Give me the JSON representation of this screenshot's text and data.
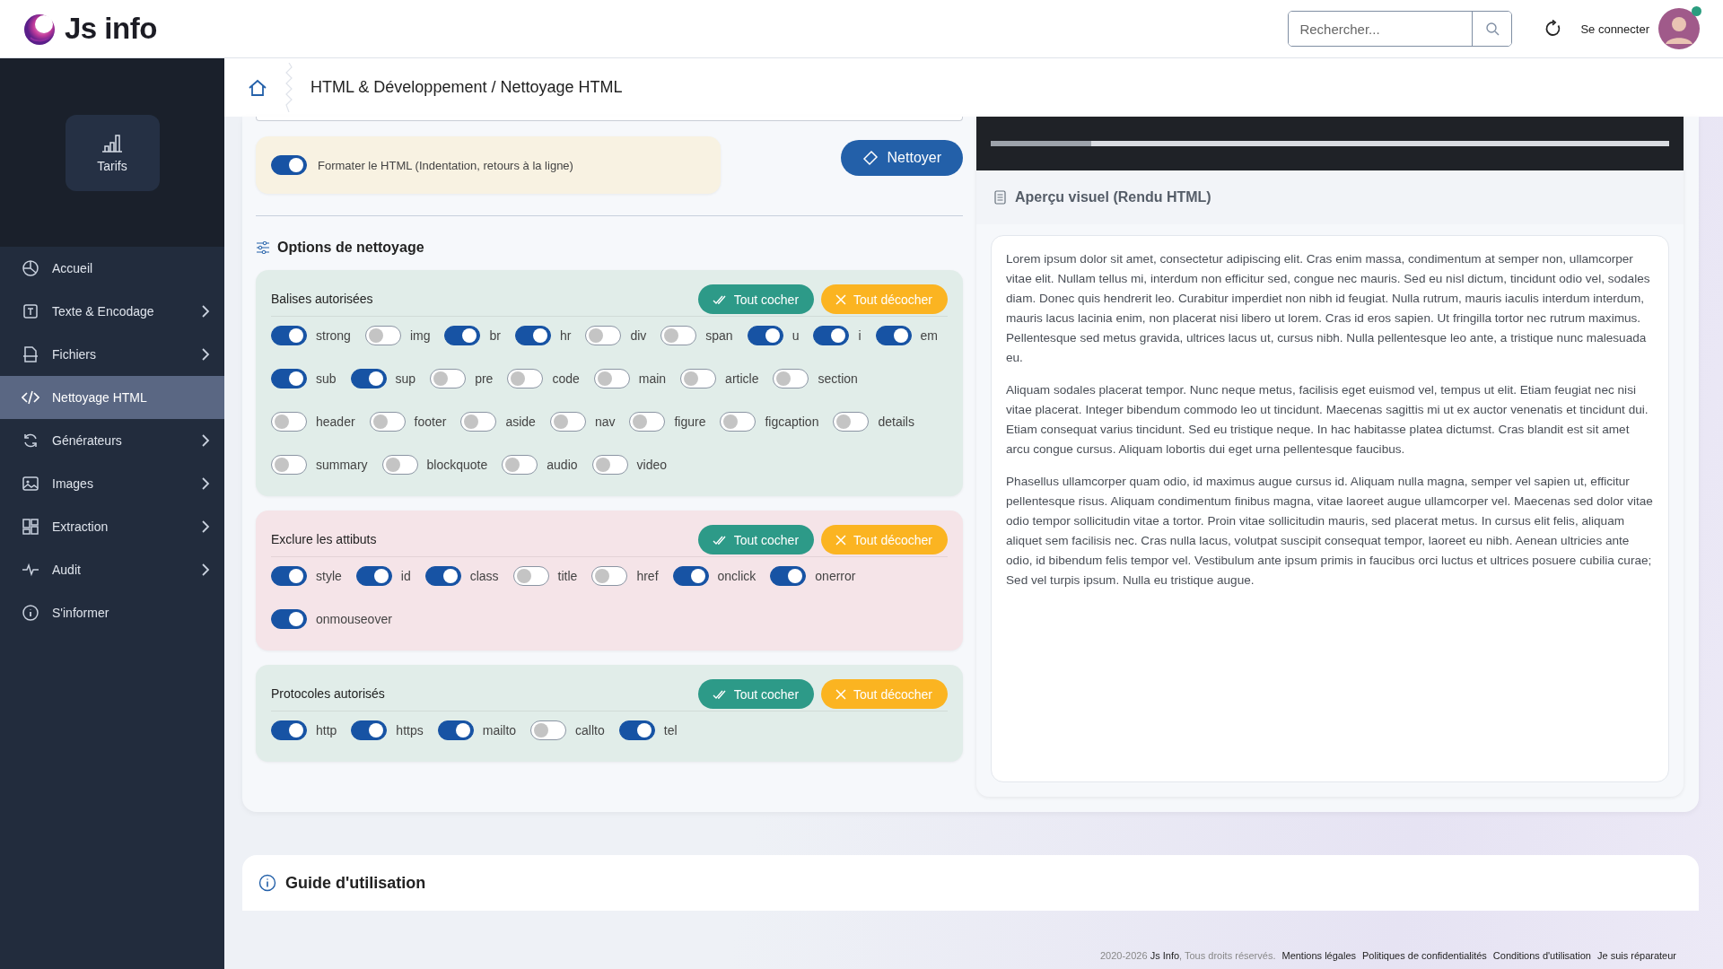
{
  "header": {
    "logo": "Js info",
    "search": {
      "placeholder": "Rechercher..."
    },
    "login": "Se connecter",
    "avatar": {
      "online": true
    }
  },
  "sidebar": {
    "promo": "Tarifs",
    "items": [
      {
        "label": "Accueil",
        "submenu": false,
        "selected": false
      },
      {
        "label": "Texte & Encodage",
        "submenu": true,
        "selected": false
      },
      {
        "label": "Fichiers",
        "submenu": true,
        "selected": false
      },
      {
        "label": "Nettoyage HTML",
        "submenu": false,
        "selected": true
      },
      {
        "label": "Générateurs",
        "submenu": true,
        "selected": false
      },
      {
        "label": "Images",
        "submenu": true,
        "selected": false
      },
      {
        "label": "Extraction",
        "submenu": true,
        "selected": false
      },
      {
        "label": "Audit",
        "submenu": true,
        "selected": false
      },
      {
        "label": "S'informer",
        "submenu": false,
        "selected": false
      }
    ]
  },
  "breadcrumb": "HTML & Développement / Nettoyage HTML",
  "format_option": {
    "label": "Formater le HTML (Indentation, retours à la ligne)",
    "on": true
  },
  "clean_button": "Nettoyer",
  "options_title": "Options de nettoyage",
  "groups": [
    {
      "kind": "allowed",
      "title": "Balises autorisées",
      "check_all": "Tout cocher",
      "uncheck_all": "Tout décocher",
      "options": [
        {
          "label": "strong",
          "on": true
        },
        {
          "label": "img",
          "on": false
        },
        {
          "label": "br",
          "on": true
        },
        {
          "label": "hr",
          "on": true
        },
        {
          "label": "div",
          "on": false
        },
        {
          "label": "span",
          "on": false
        },
        {
          "label": "u",
          "on": true
        },
        {
          "label": "i",
          "on": true
        },
        {
          "label": "em",
          "on": true
        },
        {
          "label": "sub",
          "on": true
        },
        {
          "label": "sup",
          "on": true
        },
        {
          "label": "pre",
          "on": false
        },
        {
          "label": "code",
          "on": false
        },
        {
          "label": "main",
          "on": false
        },
        {
          "label": "article",
          "on": false
        },
        {
          "label": "section",
          "on": false
        },
        {
          "label": "header",
          "on": false
        },
        {
          "label": "footer",
          "on": false
        },
        {
          "label": "aside",
          "on": false
        },
        {
          "label": "nav",
          "on": false
        },
        {
          "label": "figure",
          "on": false
        },
        {
          "label": "figcaption",
          "on": false
        },
        {
          "label": "details",
          "on": false
        },
        {
          "label": "summary",
          "on": false
        },
        {
          "label": "blockquote",
          "on": false
        },
        {
          "label": "audio",
          "on": false
        },
        {
          "label": "video",
          "on": false
        }
      ]
    },
    {
      "kind": "excluded",
      "title": "Exclure les attibuts",
      "check_all": "Tout cocher",
      "uncheck_all": "Tout décocher",
      "options": [
        {
          "label": "style",
          "on": true
        },
        {
          "label": "id",
          "on": true
        },
        {
          "label": "class",
          "on": true
        },
        {
          "label": "title",
          "on": false
        },
        {
          "label": "href",
          "on": false
        },
        {
          "label": "onclick",
          "on": true
        },
        {
          "label": "onerror",
          "on": true
        },
        {
          "label": "onmouseover",
          "on": true
        }
      ]
    },
    {
      "kind": "allowed",
      "title": "Protocoles autorisés",
      "check_all": "Tout cocher",
      "uncheck_all": "Tout décocher",
      "options": [
        {
          "label": "http",
          "on": true
        },
        {
          "label": "https",
          "on": true
        },
        {
          "label": "mailto",
          "on": true
        },
        {
          "label": "callto",
          "on": false
        },
        {
          "label": "tel",
          "on": true
        }
      ]
    }
  ],
  "preview": {
    "title": "Aperçu visuel (Rendu HTML)",
    "paragraphs": [
      "Lorem ipsum dolor sit amet, consectetur adipiscing elit. Cras enim massa, condimentum at semper non, ullamcorper vitae elit. Nullam tellus mi, interdum non efficitur sed, congue nec mauris. Sed eu nisl dictum, tincidunt odio vel, sodales diam. Donec quis hendrerit leo. Curabitur imperdiet non nibh id feugiat. Nulla rutrum, mauris iaculis interdum interdum, mauris lacus lacinia enim, non placerat nisi libero ut lorem. Cras id eros sapien. Ut fringilla tortor nec rutrum maximus. Pellentesque sed metus gravida, ultrices lacus ut, cursus nibh. Nulla pellentesque leo ante, a tristique nunc malesuada eu.",
      "Aliquam sodales placerat tempor. Nunc neque metus, facilisis eget euismod vel, tempus ut elit. Etiam feugiat nec nisi vitae placerat. Integer bibendum commodo leo ut tincidunt. Maecenas sagittis mi ut ex auctor venenatis et tincidunt dui. Etiam consequat varius tincidunt. Sed eu tristique neque. In hac habitasse platea dictumst. Cras blandit est sit amet arcu congue cursus. Aliquam lobortis dui eget urna pellentesque faucibus.",
      "Phasellus ullamcorper quam odio, id maximus augue cursus id. Aliquam nulla magna, semper vel sapien ut, efficitur pellentesque risus. Aliquam condimentum finibus magna, vitae laoreet augue ullamcorper vel. Maecenas sed dolor vitae odio tempor sollicitudin vitae a tortor. Proin vitae sollicitudin mauris, sed placerat metus. In cursus elit felis, aliquam aliquet sem facilisis nec. Cras nulla lacus, volutpat suscipit consequat tempor, laoreet eu nibh. Aenean ultricies ante odio, id bibendum felis tempor vel. Vestibulum ante ipsum primis in faucibus orci luctus et ultrices posuere cubilia curae; Sed vel turpis ipsum. Nulla eu tristique augue."
    ]
  },
  "guide": {
    "title": "Guide d'utilisation"
  },
  "footer": {
    "years": "2020-2026",
    "brand": "Js Info",
    "rights": ", Tous droits réservés.",
    "links": [
      "Mentions légales",
      "Politiques de confidentialités",
      "Conditions d'utilisation",
      "Je suis réparateur"
    ]
  }
}
